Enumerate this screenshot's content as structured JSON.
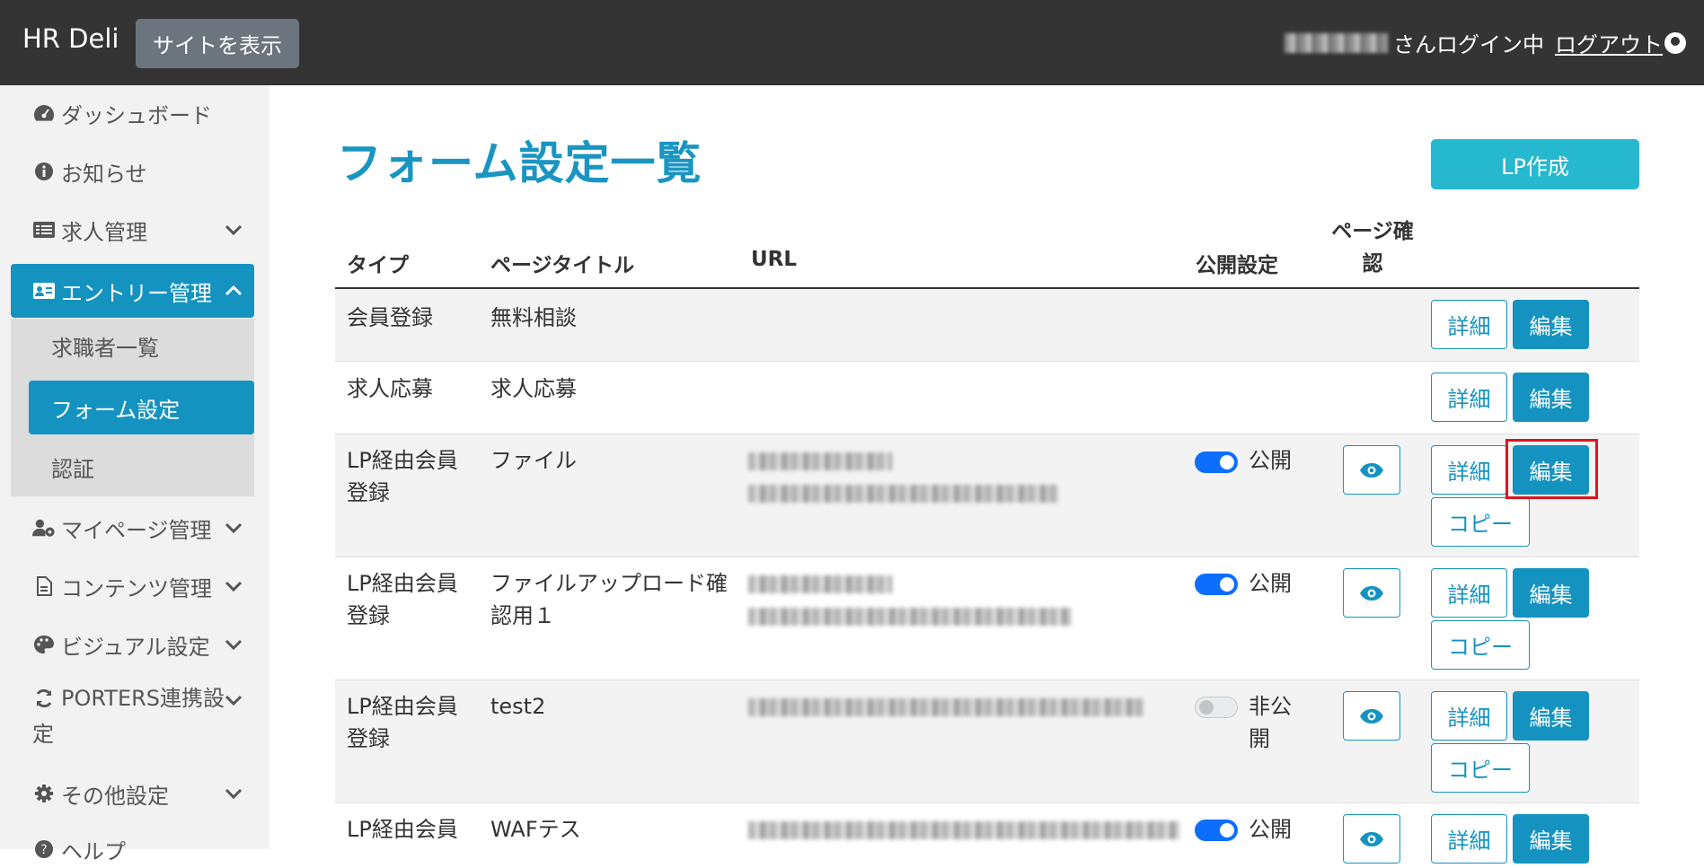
{
  "header": {
    "brand": "HR Deli",
    "site_button": "サイトを表示",
    "login_text": "さんログイン中",
    "logout": "ログアウト"
  },
  "sidebar": {
    "items": [
      {
        "label": "ダッシュボード",
        "icon": "dashboard-icon"
      },
      {
        "label": "お知らせ",
        "icon": "info-icon"
      },
      {
        "label": "求人管理",
        "icon": "list-icon"
      },
      {
        "label": "エントリー管理",
        "icon": "id-card-icon"
      },
      {
        "label": "マイページ管理",
        "icon": "user-gear-icon"
      },
      {
        "label": "コンテンツ管理",
        "icon": "file-icon"
      },
      {
        "label": "ビジュアル設定",
        "icon": "palette-icon"
      },
      {
        "label": "PORTERS連携設",
        "label2": "定",
        "icon": "sync-icon"
      },
      {
        "label": "その他設定",
        "icon": "gear-icon"
      },
      {
        "label": "ヘルプ",
        "icon": "help-icon"
      }
    ],
    "sub_items": [
      {
        "label": "求職者一覧"
      },
      {
        "label": "フォーム設定"
      },
      {
        "label": "認証"
      }
    ]
  },
  "main": {
    "title": "フォーム設定一覧",
    "lp_button": "LP作成",
    "columns": {
      "type": "タイプ",
      "page_title": "ページタイトル",
      "url": "URL",
      "publish": "公開設定",
      "page_check_1": "ページ確",
      "page_check_2": "認"
    },
    "rows": [
      {
        "type1": "会員登録",
        "type2": "",
        "title1": "無料相談",
        "title2": "",
        "publish": "",
        "detail": "詳細",
        "edit": "編集"
      },
      {
        "type1": "求人応募",
        "type2": "",
        "title1": "求人応募",
        "title2": "",
        "publish": "",
        "detail": "詳細",
        "edit": "編集"
      },
      {
        "type1": "LP経由会員",
        "type2": "登録",
        "title1": "ファイル",
        "title2": "",
        "publish": "公開",
        "detail": "詳細",
        "edit": "編集",
        "copy": "コピー"
      },
      {
        "type1": "LP経由会員",
        "type2": "登録",
        "title1": "ファイルアップロード確",
        "title2": "認用１",
        "publish": "公開",
        "detail": "詳細",
        "edit": "編集",
        "copy": "コピー"
      },
      {
        "type1": "LP経由会員",
        "type2": "登録",
        "title1": "test2",
        "title2": "",
        "publish": "非公",
        "publish2": "開",
        "detail": "詳細",
        "edit": "編集",
        "copy": "コピー"
      },
      {
        "type1": "LP経由会員",
        "type2": "",
        "title1": "WAFテス",
        "title2": "",
        "publish": "公開",
        "detail": "詳細",
        "edit": "編集"
      }
    ]
  },
  "colors": {
    "header_bg": "#343434",
    "primary": "#1593c0",
    "lp_button": "#26b8cf",
    "highlight": "#e0151b",
    "toggle_on": "#0d6efd"
  }
}
